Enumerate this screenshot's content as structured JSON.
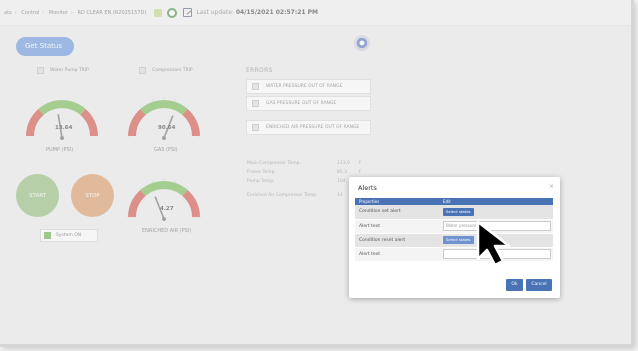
{
  "breadcrumb": [
    "ats",
    "Control",
    "Monitor",
    "RD CLEAR EN (R2025157D)"
  ],
  "last_update": {
    "label": "Last update:",
    "value": "04/15/2021 02:57:21 PM"
  },
  "get_status_label": "Get Status",
  "checks": {
    "water_pump_trip": "Water Pump TRIP",
    "compressors_trip": "Compressors TRIP"
  },
  "gauges": {
    "pump": {
      "value": "13.64",
      "label": "PUMP (PSI)",
      "level": 0.45
    },
    "gas": {
      "value": "90.64",
      "label": "GAS (PSI)",
      "level": 0.62
    },
    "enriched": {
      "value": "4.27",
      "label": "ENRICHED AIR (PSI)",
      "level": 0.38
    }
  },
  "controls": {
    "start": "START",
    "stop": "STOP",
    "system_on": "System ON"
  },
  "errors": {
    "title": "ERRORS",
    "items": [
      "WATER PRESSURE OUT OF RANGE",
      "GAS PRESSURE OUT OF RANGE",
      "ENRICHED AIR PRESSURE OUT OF RANGE"
    ]
  },
  "temps": [
    {
      "label": "Main Compressor Temp.",
      "value": "113.0",
      "unit": "F"
    },
    {
      "label": "Frame Temp.",
      "value": "85.3",
      "unit": "F"
    },
    {
      "label": "Pump Temp.",
      "value": "104.",
      "unit": "F"
    },
    {
      "label": "Enriched Air Compressor Temp.",
      "value": "14",
      "unit": ""
    }
  ],
  "modal": {
    "title": "Alerts",
    "close": "×",
    "headers": [
      "Properties",
      "Edit"
    ],
    "rows": [
      {
        "label": "Condition set alert",
        "button": "Select states"
      },
      {
        "label": "Alert text",
        "input": "Water pressure"
      },
      {
        "label": "Condition reset alert",
        "button": "Select states"
      },
      {
        "label": "Alert text",
        "input": ""
      }
    ],
    "ok": "Ok",
    "cancel": "Cancel"
  },
  "colors": {
    "accent": "#4a73b6",
    "status_green": "#5cab3e",
    "gauge_green": "#6cb444",
    "gauge_red": "#d0453a"
  }
}
